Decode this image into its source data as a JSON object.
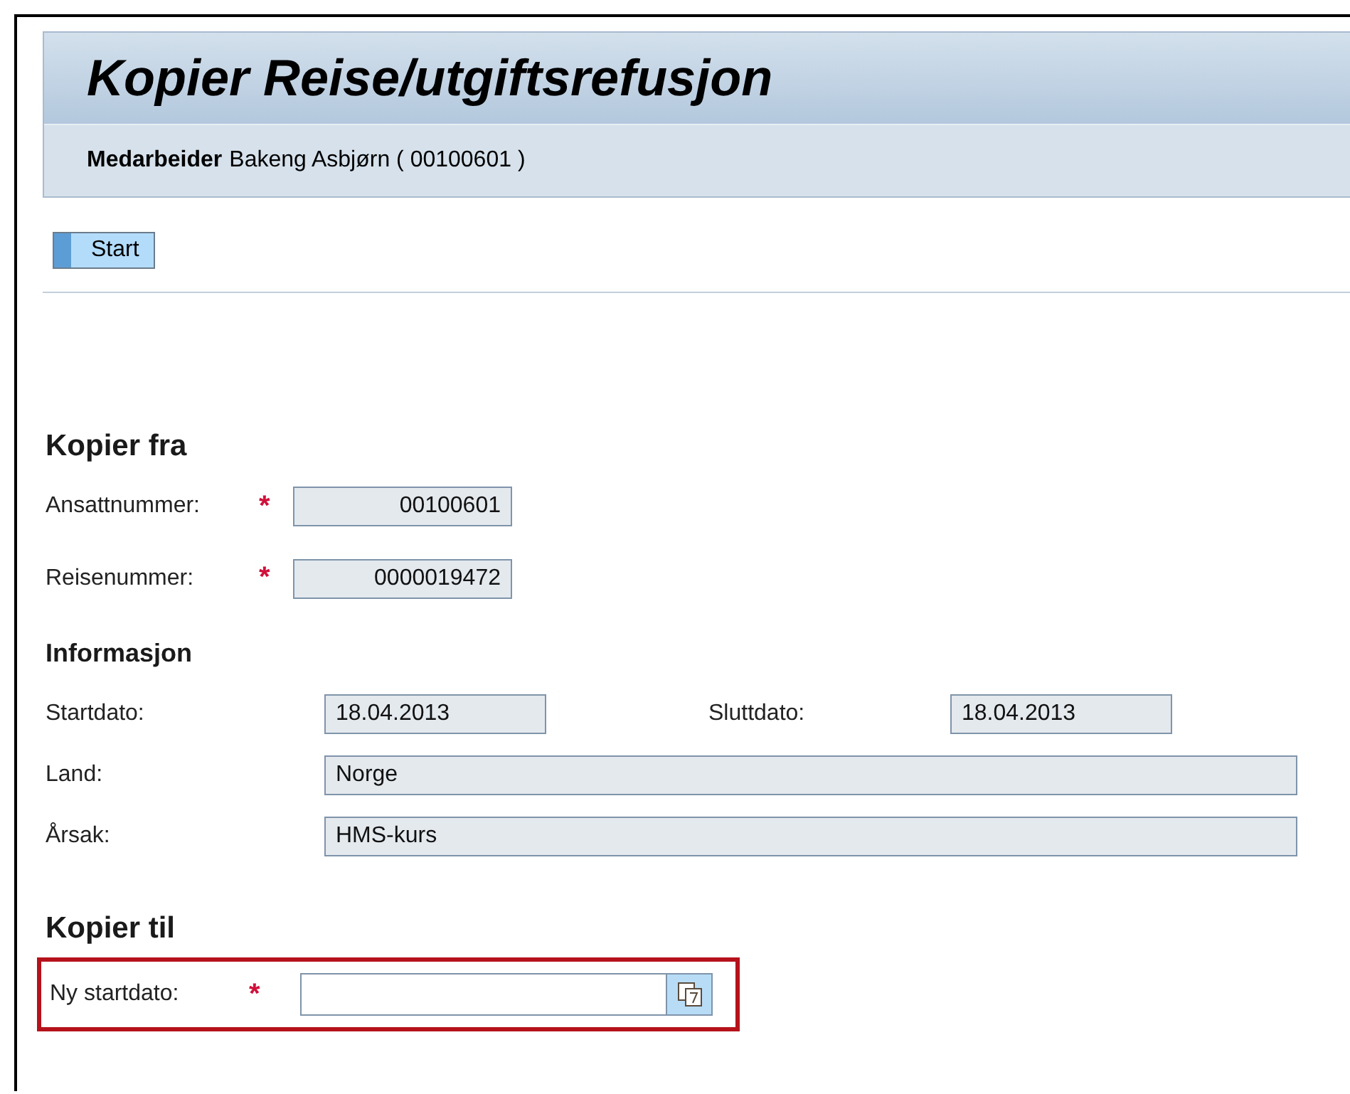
{
  "header": {
    "title": "Kopier Reise/utgiftsrefusjon",
    "subtitle_label": "Medarbeider",
    "subtitle_value": "Bakeng Asbjørn ( 00100601 )"
  },
  "toolbar": {
    "buttons": [
      "Start"
    ]
  },
  "copy_from": {
    "heading": "Kopier fra",
    "fields": [
      {
        "label": "Ansattnummer:",
        "required_mark": "*",
        "value": "00100601",
        "kind": "number"
      },
      {
        "label": "Reisenummer:",
        "required_mark": "*",
        "value": "0000019472",
        "kind": "number"
      }
    ]
  },
  "information": {
    "heading": "Informasjon",
    "start_label": "Startdato:",
    "start_value": "18.04.2013",
    "end_label": "Sluttdato:",
    "end_value": "18.04.2013",
    "rows": [
      {
        "label": "Land:",
        "value": "Norge"
      },
      {
        "label": "Årsak:",
        "value": "HMS-kurs"
      }
    ]
  },
  "copy_to": {
    "heading": "Kopier til",
    "field": {
      "label": "Ny startdato:",
      "required_mark": "*",
      "highlighted": true
    }
  }
}
